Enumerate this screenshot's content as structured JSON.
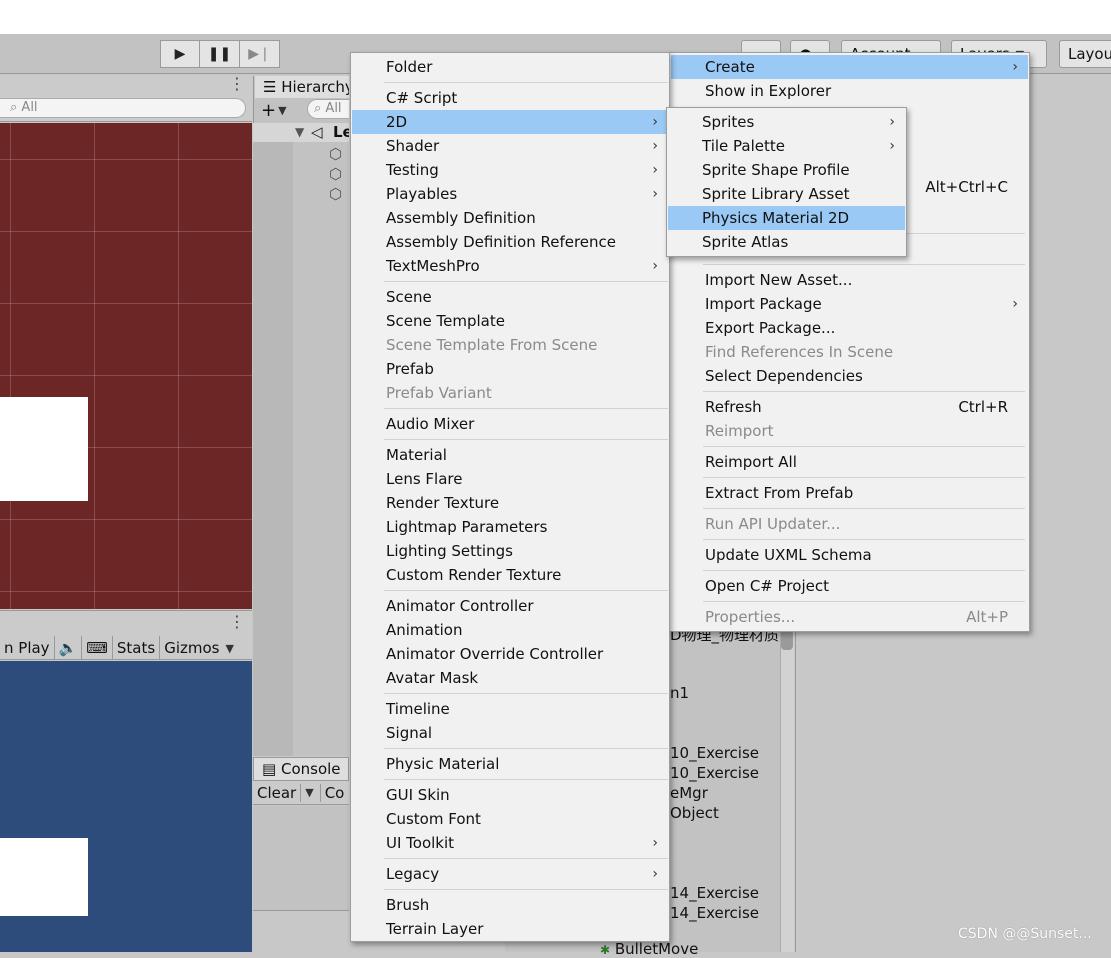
{
  "toolbar": {
    "account_label": "Account",
    "layers_label": "Layers",
    "layout_label": "Layout"
  },
  "scene": {
    "search_placeholder": "All"
  },
  "game": {
    "maximize_label": "n Play",
    "stats_label": "Stats",
    "gizmos_label": "Gizmos"
  },
  "hierarchy": {
    "tab_label": "Hierarchy",
    "add_label": "+",
    "search_placeholder": "All",
    "scene_root": "Le"
  },
  "console": {
    "tab_label": "Console",
    "clear_label": "Clear",
    "collapse_label": "Co"
  },
  "project": {
    "items": [
      "D物理_物理材质",
      "n1",
      "10_Exercise",
      "10_Exercise",
      "eMgr",
      "Object",
      "14_Exercise",
      "14_Exercise",
      "BulletMove"
    ]
  },
  "create_menu": {
    "items": [
      {
        "label": "Folder"
      },
      {
        "label": "C# Script"
      },
      {
        "label": "2D",
        "submenu": true,
        "highlighted": true
      },
      {
        "label": "Shader",
        "submenu": true
      },
      {
        "label": "Testing",
        "submenu": true
      },
      {
        "label": "Playables",
        "submenu": true
      },
      {
        "label": "Assembly Definition"
      },
      {
        "label": "Assembly Definition Reference"
      },
      {
        "label": "TextMeshPro",
        "submenu": true
      },
      {
        "label": "Scene"
      },
      {
        "label": "Scene Template"
      },
      {
        "label": "Scene Template From Scene",
        "disabled": true
      },
      {
        "label": "Prefab"
      },
      {
        "label": "Prefab Variant",
        "disabled": true
      },
      {
        "label": "Audio Mixer"
      },
      {
        "label": "Material"
      },
      {
        "label": "Lens Flare"
      },
      {
        "label": "Render Texture"
      },
      {
        "label": "Lightmap Parameters"
      },
      {
        "label": "Lighting Settings"
      },
      {
        "label": "Custom Render Texture"
      },
      {
        "label": "Animator Controller"
      },
      {
        "label": "Animation"
      },
      {
        "label": "Animator Override Controller"
      },
      {
        "label": "Avatar Mask"
      },
      {
        "label": "Timeline"
      },
      {
        "label": "Signal"
      },
      {
        "label": "Physic Material"
      },
      {
        "label": "GUI Skin"
      },
      {
        "label": "Custom Font"
      },
      {
        "label": "UI Toolkit",
        "submenu": true
      },
      {
        "label": "Legacy",
        "submenu": true
      },
      {
        "label": "Brush"
      },
      {
        "label": "Terrain Layer"
      }
    ]
  },
  "context_menu": {
    "items": [
      {
        "label": "Create",
        "submenu": true,
        "highlighted": true
      },
      {
        "label": "Show in Explorer"
      },
      {
        "label": "",
        "shortcut": "Alt+Ctrl+C"
      },
      {
        "label": "Import New Asset..."
      },
      {
        "label": "Import Package",
        "submenu": true
      },
      {
        "label": "Export Package..."
      },
      {
        "label": "Find References In Scene",
        "disabled": true
      },
      {
        "label": "Select Dependencies"
      },
      {
        "label": "Refresh",
        "shortcut": "Ctrl+R"
      },
      {
        "label": "Reimport",
        "disabled": true
      },
      {
        "label": "Reimport All"
      },
      {
        "label": "Extract From Prefab"
      },
      {
        "label": "Run API Updater...",
        "disabled": true
      },
      {
        "label": "Update UXML Schema"
      },
      {
        "label": "Open C# Project"
      },
      {
        "label": "Properties...",
        "shortcut": "Alt+P",
        "disabled": true
      }
    ]
  },
  "submenu_2d": {
    "items": [
      {
        "label": "Sprites",
        "submenu": true
      },
      {
        "label": "Tile Palette",
        "submenu": true
      },
      {
        "label": "Sprite Shape Profile"
      },
      {
        "label": "Sprite Library Asset"
      },
      {
        "label": "Physics Material 2D",
        "highlighted": true
      },
      {
        "label": "Sprite Atlas"
      }
    ]
  },
  "watermark": "CSDN @@Sunset...",
  "colors": {
    "menu_bg": "#f1f1f1",
    "highlight": "#99c9f4",
    "scene_bg": "#6b2625",
    "game_bg": "#2d4c7c",
    "disabled_text": "#8a8a8a"
  }
}
